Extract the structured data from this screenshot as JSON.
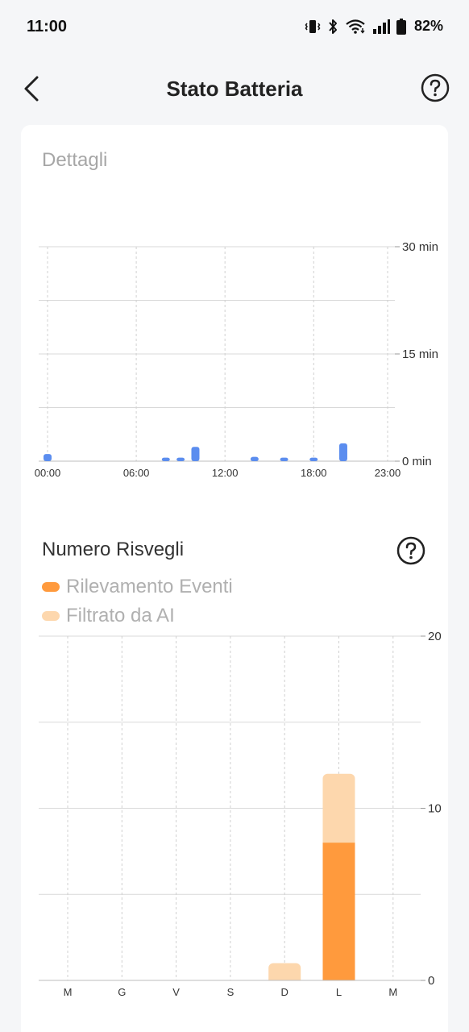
{
  "status_bar": {
    "time": "11:00",
    "battery_percent": "82%",
    "icons": [
      "vibrate-icon",
      "bluetooth-icon",
      "wifi-icon",
      "signal-icon",
      "battery-icon"
    ]
  },
  "header": {
    "title": "Stato Batteria",
    "back_icon": "chevron-left-icon",
    "help_icon": "help-circle-icon"
  },
  "details": {
    "title": "Dettagli"
  },
  "wakeups": {
    "title": "Numero Risvegli",
    "help_icon": "help-circle-icon",
    "legend": [
      {
        "label": "Rilevamento Eventi",
        "color": "#ff9a3d"
      },
      {
        "label": "Filtrato da AI",
        "color": "#fdd7ad"
      }
    ]
  },
  "colors": {
    "accent_blue": "#5b8def",
    "orange": "#ff9a3d",
    "light_orange": "#fdd7ad"
  },
  "chart_data": [
    {
      "type": "bar",
      "title": "Dettagli",
      "x_tick_labels": [
        "00:00",
        "06:00",
        "12:00",
        "18:00",
        "23:00"
      ],
      "y_tick_labels": [
        "30 min",
        "15 min",
        "0 min"
      ],
      "ylim": [
        0,
        30
      ],
      "grid": true,
      "series": [
        {
          "color": "#5b8def",
          "x": [
            0,
            8,
            9,
            10,
            14,
            16,
            18,
            20
          ],
          "values": [
            1,
            0.5,
            0.5,
            2,
            0.6,
            0.5,
            0.5,
            2.5
          ]
        }
      ]
    },
    {
      "type": "bar",
      "stacked": true,
      "title": "Numero Risvegli",
      "categories": [
        "M",
        "G",
        "V",
        "S",
        "D",
        "L",
        "M"
      ],
      "y_tick_labels": [
        "20",
        "10",
        "0"
      ],
      "ylim": [
        0,
        20
      ],
      "grid": true,
      "legend_position": "top-left",
      "series": [
        {
          "name": "Rilevamento Eventi",
          "color": "#ff9a3d",
          "values": [
            0,
            0,
            0,
            0,
            0,
            8,
            0
          ]
        },
        {
          "name": "Filtrato da AI",
          "color": "#fdd7ad",
          "values": [
            0,
            0,
            0,
            0,
            1,
            4,
            0
          ]
        }
      ]
    }
  ]
}
